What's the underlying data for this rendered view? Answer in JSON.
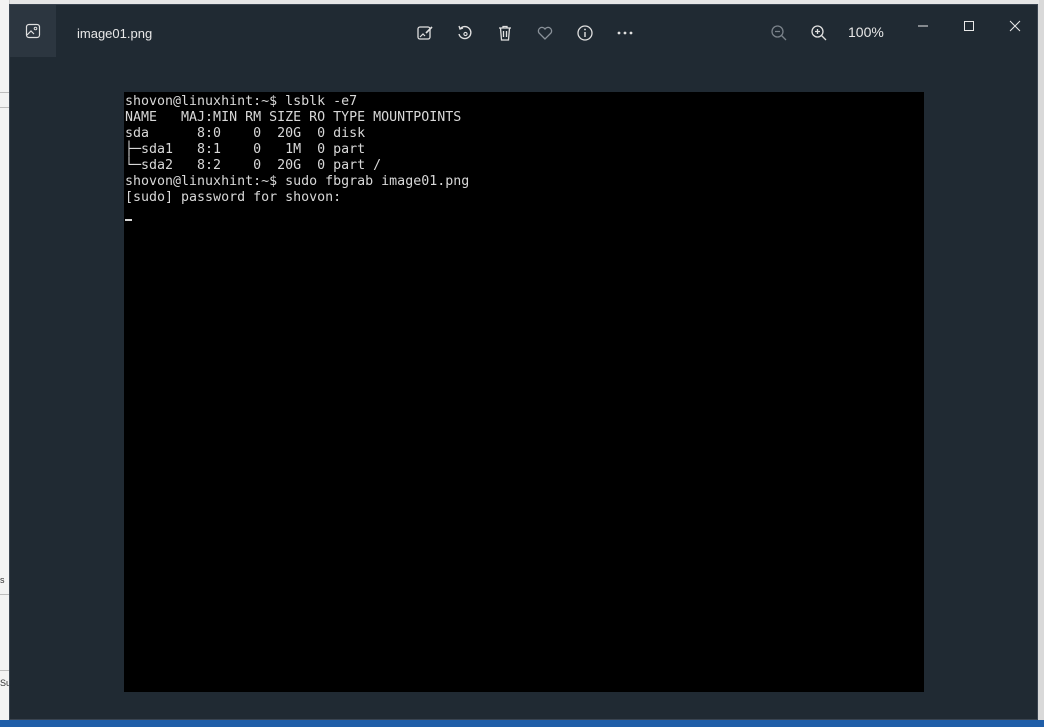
{
  "window": {
    "title": "image01.png",
    "zoom_level": "100%",
    "toolbar": {
      "edit_icon": "edit-image-icon",
      "rotate_icon": "rotate-icon",
      "delete_icon": "trash-icon",
      "favorite_icon": "heart-icon",
      "info_icon": "info-icon",
      "more_icon": "more-dots-icon",
      "zoom_out_icon": "zoom-out-icon",
      "zoom_in_icon": "zoom-in-icon"
    },
    "controls": [
      "minimize-icon",
      "maximize-icon",
      "close-icon"
    ]
  },
  "background": {
    "left_text_1": "s",
    "left_text_2": "Su"
  },
  "terminal": {
    "lines": [
      "shovon@linuxhint:~$ lsblk -e7",
      "NAME   MAJ:MIN RM SIZE RO TYPE MOUNTPOINTS",
      "sda      8:0    0  20G  0 disk",
      "├─sda1   8:1    0   1M  0 part",
      "└─sda2   8:2    0  20G  0 part /",
      "shovon@linuxhint:~$ sudo fbgrab image01.png",
      "[sudo] password for shovon:"
    ]
  },
  "colors": {
    "window_bg": "#202a33",
    "terminal_bg": "#000000",
    "terminal_fg": "#d8d8d8"
  }
}
